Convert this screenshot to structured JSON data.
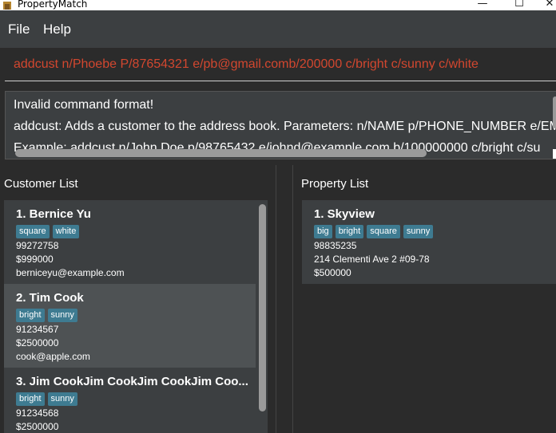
{
  "window": {
    "title": "PropertyMatch",
    "controls": [
      "—",
      "☐",
      "✕"
    ]
  },
  "menu": {
    "items": [
      "File",
      "Help"
    ]
  },
  "command": {
    "value": "addcust n/Phoebe P/87654321 e/pb@gmail.comb/200000 c/bright c/sunny c/white"
  },
  "result": {
    "lines": [
      "Invalid command format!",
      "addcust: Adds a customer to the address book. Parameters: n/NAME p/PHONE_NUMBER e/EM",
      "Example: addcust n/John Doe p/98765432 e/johnd@example.com b/100000000 c/bright c/su"
    ]
  },
  "customer_list": {
    "title": "Customer List",
    "customers": [
      {
        "header": "1.  Bernice Yu",
        "tags": [
          "square",
          "white"
        ],
        "phone": "99272758",
        "budget": "$999000",
        "email": "berniceyu@example.com"
      },
      {
        "header": "2.  Tim Cook",
        "tags": [
          "bright",
          "sunny"
        ],
        "phone": "91234567",
        "budget": "$2500000",
        "email": "cook@apple.com"
      },
      {
        "header": "3.  Jim CookJim CookJim CookJim Coo...",
        "tags": [
          "bright",
          "sunny"
        ],
        "phone": "91234568",
        "budget": "$2500000",
        "email": ""
      }
    ]
  },
  "property_list": {
    "title": "Property List",
    "properties": [
      {
        "header": "1.  Skyview",
        "tags": [
          "big",
          "bright",
          "square",
          "sunny"
        ],
        "phone": "98835235",
        "address": "214 Clementi Ave 2 #09-78",
        "price": "$500000"
      }
    ]
  },
  "colors": {
    "background": "#2b2b2b",
    "panel": "#3c3f41",
    "selected": "#4e5254",
    "tag": "#3e7b91",
    "error_text": "#d2472f"
  },
  "icons": {
    "app": "house-icon",
    "minimize": "minimize-icon",
    "maximize": "maximize-icon",
    "close": "close-icon"
  }
}
